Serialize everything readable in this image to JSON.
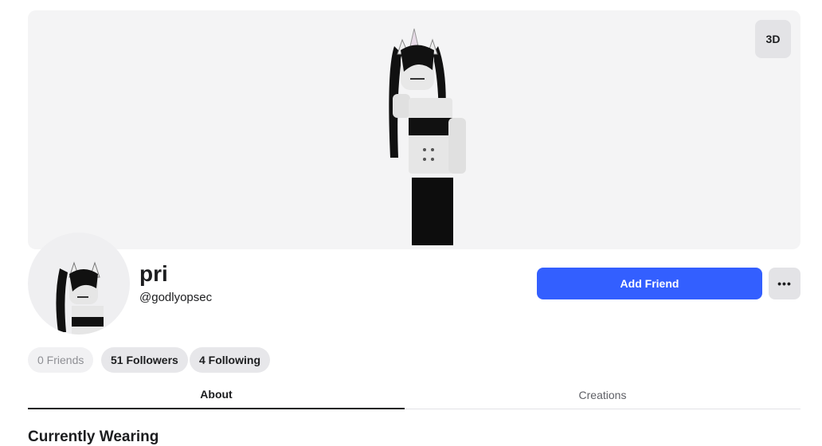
{
  "banner": {
    "view_toggle_label": "3D"
  },
  "profile": {
    "display_name": "pri",
    "username": "@godlyopsec"
  },
  "actions": {
    "add_friend_label": "Add Friend",
    "more_label": "•••"
  },
  "stats": {
    "friends": "0 Friends",
    "followers": "51 Followers",
    "following": "4 Following"
  },
  "tabs": [
    {
      "label": "About",
      "active": true
    },
    {
      "label": "Creations",
      "active": false
    }
  ],
  "sections": {
    "currently_wearing": "Currently Wearing"
  },
  "colors": {
    "primary": "#335fff",
    "banner_bg": "#f4f4f5"
  }
}
